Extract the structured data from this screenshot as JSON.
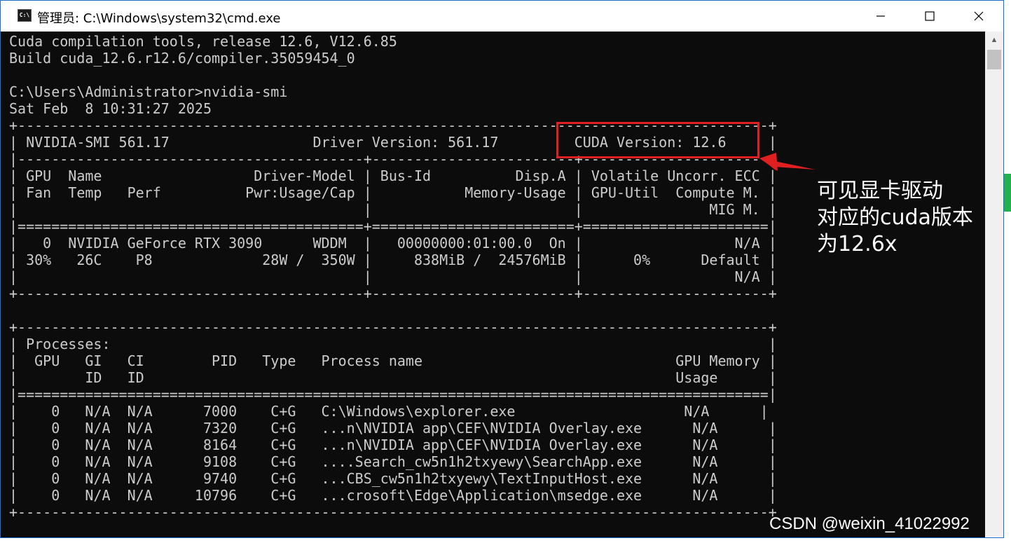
{
  "window": {
    "title": "管理员: C:\\Windows\\system32\\cmd.exe",
    "icon_label": "C:\\"
  },
  "controls": {
    "minimize": "minimize-icon",
    "maximize": "maximize-icon",
    "close": "close-icon"
  },
  "console": {
    "lines": [
      "Cuda compilation tools, release 12.6, V12.6.85",
      "Build cuda_12.6.r12.6/compiler.35059454_0",
      "",
      "C:\\Users\\Administrator>nvidia-smi",
      "Sat Feb  8 10:31:27 2025",
      "+-----------------------------------------------------------------------------------------+",
      "| NVIDIA-SMI 561.17                 Driver Version: 561.17         CUDA Version: 12.6     |",
      "|-----------------------------------------+------------------------+----------------------+",
      "| GPU  Name                  Driver-Model | Bus-Id          Disp.A | Volatile Uncorr. ECC |",
      "| Fan  Temp   Perf          Pwr:Usage/Cap |           Memory-Usage | GPU-Util  Compute M. |",
      "|                                         |                        |               MIG M. |",
      "|=========================================+========================+======================|",
      "|   0  NVIDIA GeForce RTX 3090      WDDM  |   00000000:01:00.0  On |                  N/A |",
      "| 30%   26C    P8             28W /  350W |     838MiB /  24576MiB |      0%      Default |",
      "|                                         |                        |                  N/A |",
      "+-----------------------------------------+------------------------+----------------------+",
      "",
      "+-----------------------------------------------------------------------------------------+",
      "| Processes:                                                                              |",
      "|  GPU   GI   CI        PID   Type   Process name                              GPU Memory |",
      "|        ID   ID                                                               Usage      |",
      "|=========================================================================================|",
      "|    0   N/A  N/A      7000    C+G   C:\\Windows\\explorer.exe                    N/A      |",
      "|    0   N/A  N/A      7320    C+G   ...n\\NVIDIA app\\CEF\\NVIDIA Overlay.exe      N/A      |",
      "|    0   N/A  N/A      8164    C+G   ...n\\NVIDIA app\\CEF\\NVIDIA Overlay.exe      N/A      |",
      "|    0   N/A  N/A      9108    C+G   ....Search_cw5n1h2txyewy\\SearchApp.exe      N/A      |",
      "|    0   N/A  N/A      9740    C+G   ...CBS_cw5n1h2txyewy\\TextInputHost.exe      N/A      |",
      "|    0   N/A  N/A     10796    C+G   ...crosoft\\Edge\\Application\\msedge.exe      N/A      |",
      "+-----------------------------------------------------------------------------------------+"
    ]
  },
  "annotation": {
    "color": "#e02020",
    "lines": [
      "可见显卡驱动",
      "对应的cuda版本",
      "为12.6x"
    ]
  },
  "watermark": "CSDN @weixin_41022992"
}
